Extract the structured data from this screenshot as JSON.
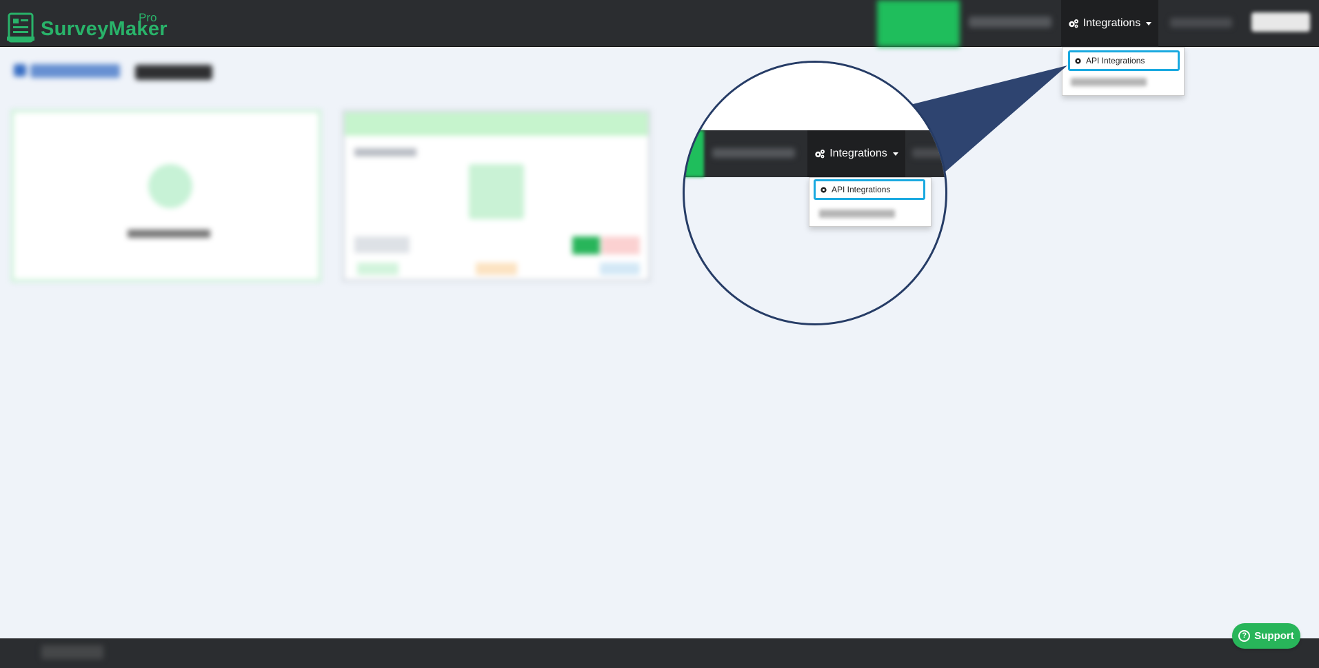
{
  "header": {
    "brand": "SurveyMaker",
    "brand_suffix": "Pro",
    "integrations_label": "Integrations"
  },
  "dropdown": {
    "api_integrations_label": "API Integrations"
  },
  "footer": {
    "support_label": "Support",
    "support_icon_glyph": "?"
  },
  "colors": {
    "brand_green": "#29b36a",
    "navbar_bg": "#2b2d30",
    "highlight_blue": "#1aa9e0",
    "magnifier_border": "#263c66"
  },
  "icons": {
    "integrations": "gears-icon",
    "api_item": "gear-icon",
    "support": "help-circle-icon"
  }
}
